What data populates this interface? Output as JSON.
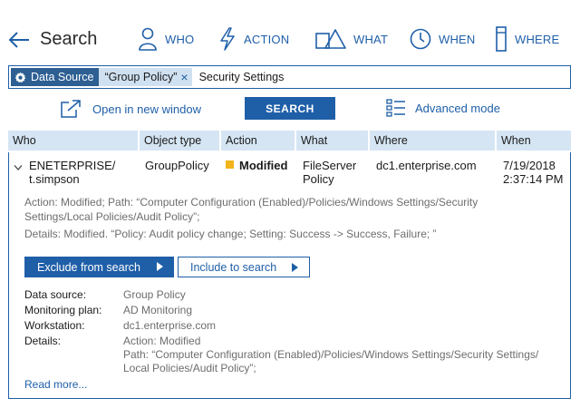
{
  "header": {
    "title": "Search",
    "nav": [
      {
        "label": "WHO",
        "icon": "person-icon"
      },
      {
        "label": "ACTION",
        "icon": "lightning-icon"
      },
      {
        "label": "WHAT",
        "icon": "shapes-icon"
      },
      {
        "label": "WHEN",
        "icon": "clock-icon"
      },
      {
        "label": "WHERE",
        "icon": "server-icon"
      }
    ]
  },
  "search": {
    "filter_label": "Data Source",
    "filter_value": "“Group Policy”",
    "query": "Security Settings"
  },
  "actions": {
    "open_window": "Open in new window",
    "search_button": "SEARCH",
    "advanced_mode": "Advanced mode"
  },
  "table": {
    "columns": [
      "Who",
      "Object type",
      "Action",
      "What",
      "Where",
      "When"
    ],
    "row": {
      "who_line1": "ENETERPRISE/",
      "who_line2": "t.simpson",
      "object_type": "GroupPolicy",
      "action": "Modified",
      "what_line1": "FileServer",
      "what_line2": "Policy",
      "where": "dc1.enterprise.com",
      "when_date": "7/19/2018",
      "when_time": "2:37:14 PM",
      "summary_line1": "Action: Modified; Path: “Computer Configuration (Enabled)/Policies/Windows Settings/Security",
      "summary_line2": "Settings/Local Policies/Audit Policy”;",
      "summary_line3": "Details: Modified. “Policy: Audit policy change; Setting: Success -> Success, Failure; ”"
    }
  },
  "detail": {
    "exclude_button": "Exclude from search",
    "include_button": "Include to search",
    "fields": [
      {
        "key": "Data source:",
        "value": "Group Policy"
      },
      {
        "key": "Monitoring plan:",
        "value": "AD Monitoring"
      },
      {
        "key": "Workstation:",
        "value": "dc1.enterprise.com"
      },
      {
        "key": "Details:",
        "value": "Action: Modified"
      }
    ],
    "details_path_line1": "Path: “Computer Configuration (Enabled)/Policies/Windows Settings/Security Settings/",
    "details_path_line2": "Local Policies/Audit Policy”;",
    "read_more": "Read more..."
  },
  "colors": {
    "accent": "#1f5fa8",
    "header_row": "#d5e5f4",
    "chip_dark": "#2d5f93",
    "chip_light": "#cfe0f1",
    "modified": "#f2b41a"
  }
}
